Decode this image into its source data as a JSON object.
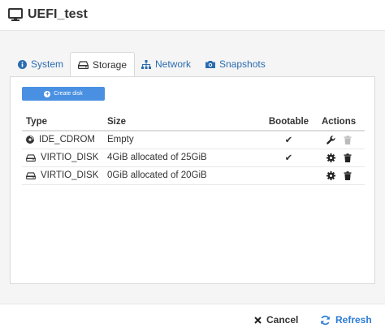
{
  "window": {
    "title": "UEFI_test"
  },
  "tabs": [
    {
      "label": "System",
      "icon": "info-circle-icon"
    },
    {
      "label": "Storage",
      "icon": "hdd-icon",
      "active": true
    },
    {
      "label": "Network",
      "icon": "sitemap-icon"
    },
    {
      "label": "Snapshots",
      "icon": "camera-icon"
    }
  ],
  "storage": {
    "create_label": "Create disk",
    "columns": [
      "Type",
      "Size",
      "Bootable",
      "Actions"
    ],
    "rows": [
      {
        "type": "IDE_CDROM",
        "type_icon": "disc-icon",
        "size": "Empty",
        "bootable": "✔",
        "actions": [
          "wrench-icon",
          "trash-icon"
        ]
      },
      {
        "type": "VIRTIO_DISK",
        "type_icon": "hdd-icon",
        "size": "4GiB allocated of 25GiB",
        "bootable": "✔",
        "actions": [
          "gear-icon",
          "trash-icon"
        ]
      },
      {
        "type": "VIRTIO_DISK",
        "type_icon": "hdd-icon",
        "size": "0GiB allocated of 20GiB",
        "bootable": "",
        "actions": [
          "gear-icon",
          "trash-icon"
        ]
      }
    ]
  },
  "footer": {
    "cancel_label": "Cancel",
    "refresh_label": "Refresh"
  },
  "colors": {
    "accent": "#2b7bd6",
    "button": "#4a90e2"
  }
}
